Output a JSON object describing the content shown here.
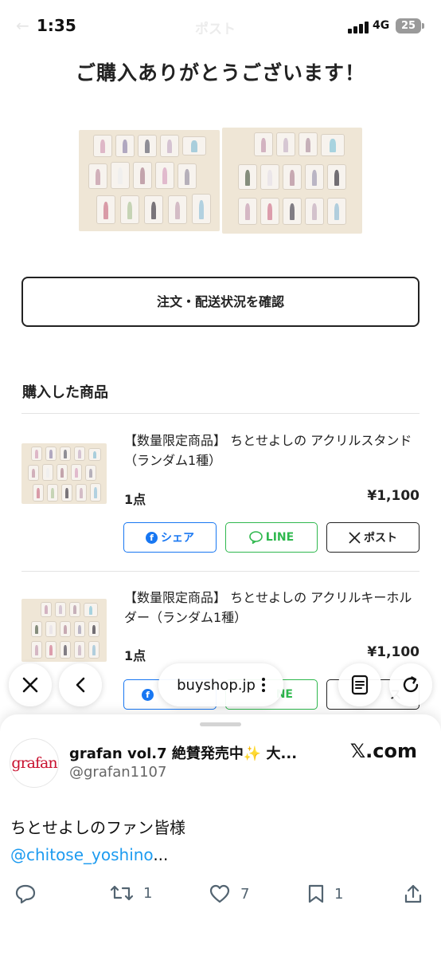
{
  "status_bar": {
    "time": "1:35",
    "network": "4G",
    "battery": "25",
    "ghost_back": "←",
    "ghost_title": "ポスト"
  },
  "page": {
    "thanks_heading": "ご購入ありがとうございます！",
    "order_status_button": "注文・配送状況を確認",
    "section_title": "購入した商品"
  },
  "items": [
    {
      "name": "【数量限定商品】 ちとせよしの アクリルスタンド（ランダム1種）",
      "quantity": "1点",
      "price": "¥1,100"
    },
    {
      "name": "【数量限定商品】 ちとせよしの アクリルキーホルダー（ランダム1種）",
      "quantity": "1点",
      "price": "¥1,100"
    }
  ],
  "share": {
    "facebook": "シェア",
    "line": "LINE",
    "x_post": "ポスト",
    "x_post_partial": "ス",
    "facebook_partial": "f"
  },
  "browser": {
    "url": "buyshop.jp"
  },
  "tweet_card": {
    "avatar_text": "grafan",
    "account_name": "grafan vol.7 絶賛発売中✨ 大...",
    "handle": "@grafan1107",
    "site": "𝕏.com",
    "text": "ちとせよしのファン皆様",
    "mention": "@chitose_yoshino",
    "mention_ellipsis": "...",
    "retweets": "1",
    "likes": "7",
    "bookmarks": "1"
  },
  "colors": {
    "facebook": "#1877f2",
    "line": "#2fb84e",
    "link": "#1d9bf0",
    "grafan_red": "#c8102e"
  }
}
